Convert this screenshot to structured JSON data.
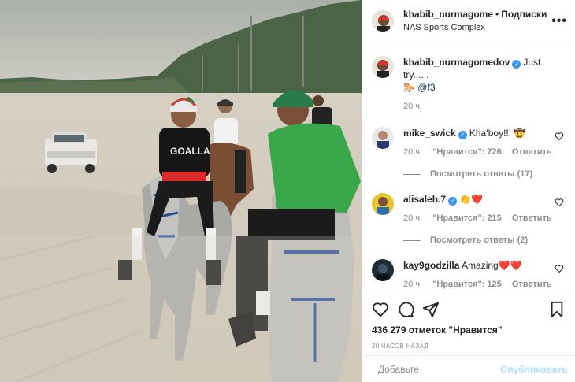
{
  "header": {
    "username": "khabib_nurmagome",
    "separator": "•",
    "follow_label": "Подписки",
    "location": "NAS Sports Complex",
    "more_icon": "more-horizontal-icon"
  },
  "caption": {
    "username": "khabib_nurmagomedov",
    "verified": true,
    "text": "Just try......",
    "emoji": "🐎",
    "mention": "@f3",
    "time": "20 ч."
  },
  "comments": [
    {
      "username": "mike_swick",
      "verified": true,
      "text": "Kha’boy!!! 🤠",
      "time": "20 ч.",
      "likes": "\"Нравится\": 726",
      "reply_label": "Ответить",
      "view_replies": "Посмотреть ответы (17)"
    },
    {
      "username": "alisaleh.7",
      "verified": true,
      "text": "👏❤️",
      "time": "20 ч.",
      "likes": "\"Нравится\": 215",
      "reply_label": "Ответить",
      "view_replies": "Посмотреть ответы (2)"
    },
    {
      "username": "kay9godzilla",
      "verified": false,
      "text": "Amazing❤️❤️",
      "time": "20 ч.",
      "likes": "\"Нравится\": 125",
      "reply_label": "Ответить",
      "view_replies": ""
    }
  ],
  "actions": {
    "likes_text": "436 279 отметок \"Нравится\"",
    "date_text": "20 ЧАСОВ НАЗАД"
  },
  "add_comment": {
    "placeholder": "Добавьте",
    "publish_label": "Опубликовать"
  },
  "photo": {
    "shirt_text": "GOALLA",
    "colors": {
      "sky": "#c9c7bd",
      "sand": "#d9d3c6",
      "trees": "#3f5a3a",
      "green_shirt": "#3aa84a"
    }
  }
}
